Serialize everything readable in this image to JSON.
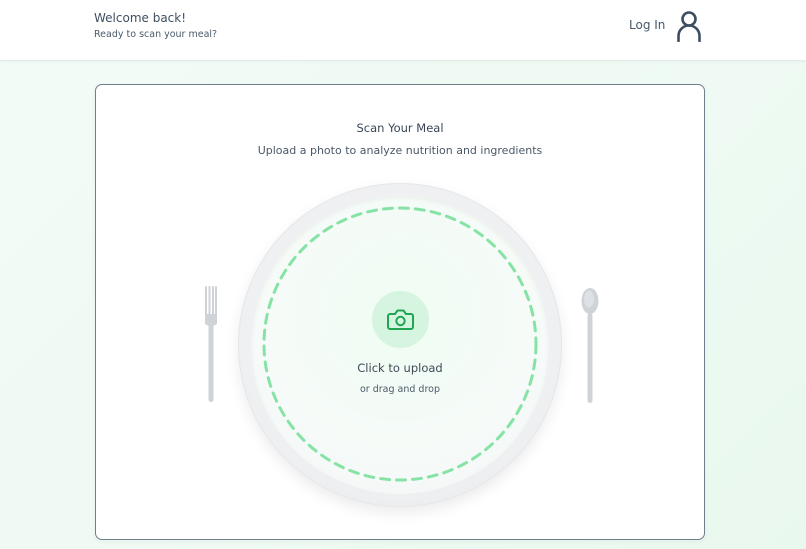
{
  "header": {
    "welcome_title": "Welcome back!",
    "welcome_subtitle": "Ready to scan your meal?",
    "login_label": "Log In",
    "user_icon": "user-icon"
  },
  "scan": {
    "title": "Scan Your Meal",
    "subtitle": "Upload a photo to analyze nutrition and ingredients",
    "upload_label": "Click to upload",
    "upload_hint": "or drag and drop",
    "camera_icon": "camera-icon",
    "fork_icon": "fork-icon",
    "spoon_icon": "spoon-icon"
  },
  "colors": {
    "accent": "#22a552",
    "dashed_ring": "#86e3a5",
    "camera_bg": "#d6f5e0",
    "page_bg": "#eefaf3",
    "text": "#3b4a5a"
  }
}
